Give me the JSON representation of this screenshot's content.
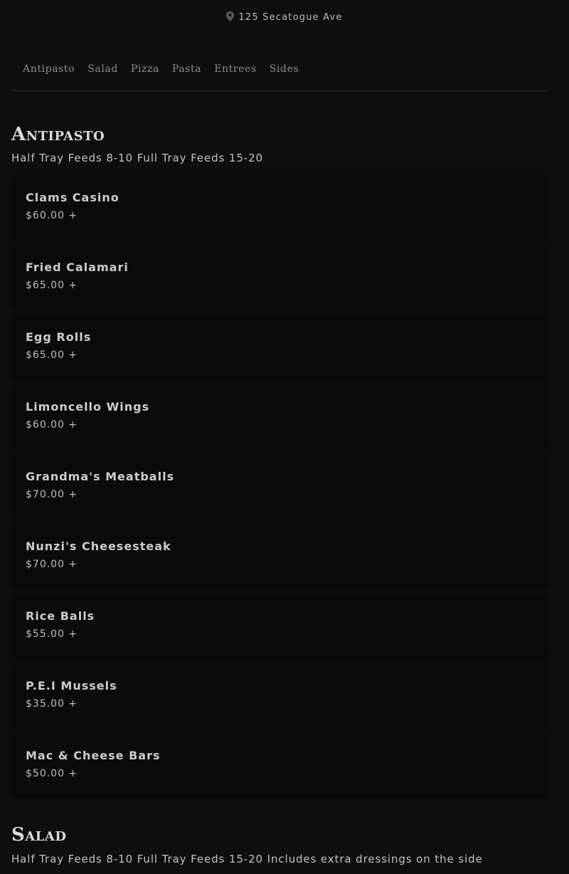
{
  "header": {
    "address": "125 Secatogue Ave",
    "address_icon": "location-pin-icon"
  },
  "tabs": [
    {
      "label": "Antipasto"
    },
    {
      "label": "Salad"
    },
    {
      "label": "Pizza"
    },
    {
      "label": "Pasta"
    },
    {
      "label": "Entrees"
    },
    {
      "label": "Sides"
    }
  ],
  "sections": [
    {
      "title": "Antipasto",
      "subtitle": "Half Tray Feeds 8-10 Full Tray Feeds 15-20",
      "items": [
        {
          "name": "Clams Casino",
          "price": "$60.00 +"
        },
        {
          "name": "Fried Calamari",
          "price": "$65.00 +"
        },
        {
          "name": "Egg Rolls",
          "price": "$65.00 +"
        },
        {
          "name": "Limoncello Wings",
          "price": "$60.00 +"
        },
        {
          "name": "Grandma's Meatballs",
          "price": "$70.00 +"
        },
        {
          "name": "Nunzi's Cheesesteak",
          "price": "$70.00 +"
        },
        {
          "name": "Rice Balls",
          "price": "$55.00 +"
        },
        {
          "name": "P.E.I Mussels",
          "price": "$35.00 +"
        },
        {
          "name": "Mac & Cheese Bars",
          "price": "$50.00 +"
        }
      ]
    },
    {
      "title": "Salad",
      "subtitle": "Half Tray Feeds 8-10 Full Tray Feeds 15-20 Includes extra dressings on the side",
      "items": []
    }
  ]
}
